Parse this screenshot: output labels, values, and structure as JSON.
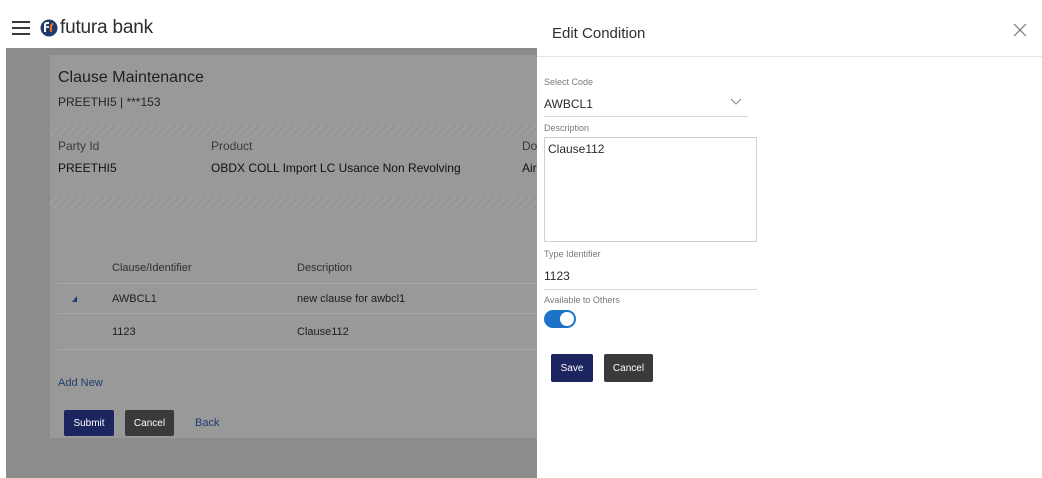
{
  "brand": {
    "name": "futura bank"
  },
  "page": {
    "title": "Clause Maintenance",
    "subtitle": "PREETHI5 | ***153"
  },
  "party": {
    "party_id_label": "Party Id",
    "party_id_value": "PREETHI5",
    "product_label": "Product",
    "product_value": "OBDX COLL Import LC Usance Non Revolving",
    "doc_label_partial": "Doc",
    "doc_value_partial": "Air"
  },
  "table": {
    "headers": [
      "Clause/Identifier",
      "Description"
    ],
    "rows": [
      {
        "identifier": "AWBCL1",
        "description": "new clause for awbcl1"
      },
      {
        "identifier": "1123",
        "description": "Clause112"
      }
    ]
  },
  "actions": {
    "add_new": "Add New",
    "submit": "Submit",
    "cancel": "Cancel",
    "back": "Back"
  },
  "drawer": {
    "title": "Edit Condition",
    "select_code_label": "Select Code",
    "select_code_value": "AWBCL1",
    "description_label": "Description",
    "description_value": "Clause112",
    "type_identifier_label": "Type Identifier",
    "type_identifier_value": "1123",
    "available_label": "Available to Others",
    "available_on": true,
    "save": "Save",
    "cancel": "Cancel"
  },
  "colors": {
    "primary": "#1d2560",
    "toggle": "#1e73c8",
    "logo_orange": "#f26b21",
    "logo_blue": "#1f3b6e"
  }
}
